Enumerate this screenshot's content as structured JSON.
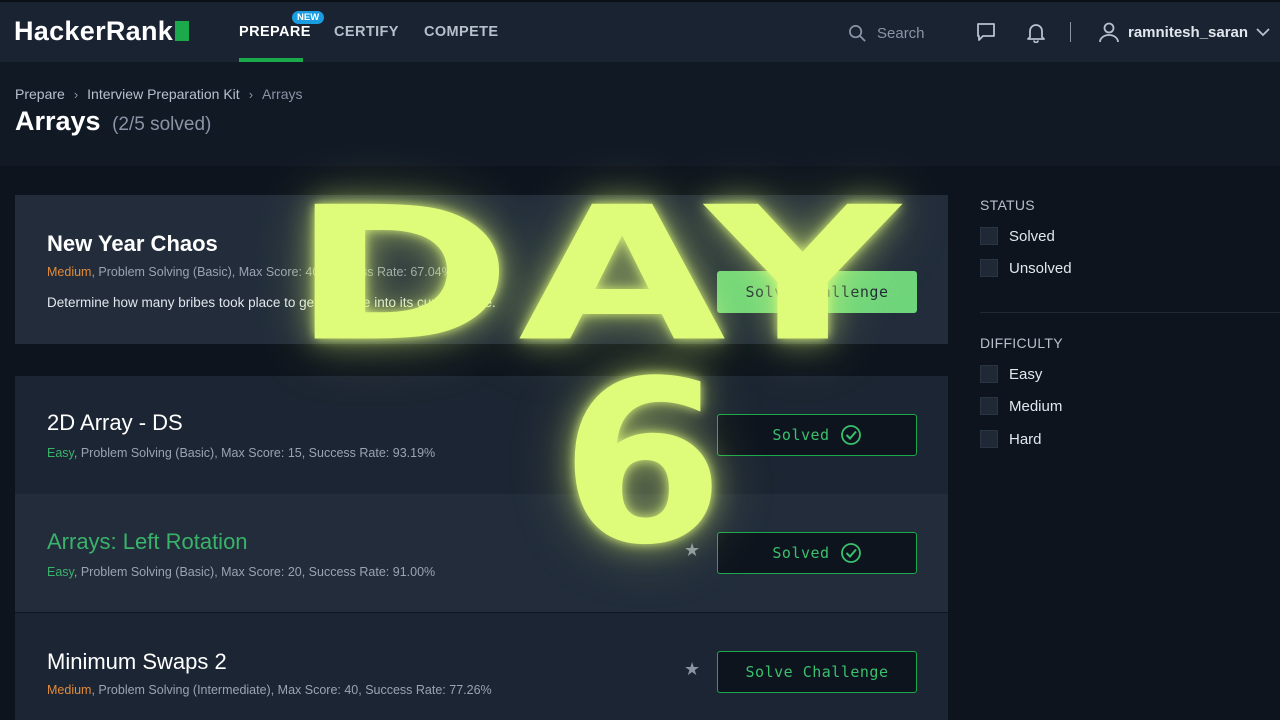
{
  "nav": {
    "logo": "HackerRank",
    "items": [
      {
        "label": "PREPARE",
        "active": true,
        "badge": "NEW"
      },
      {
        "label": "CERTIFY",
        "active": false
      },
      {
        "label": "COMPETE",
        "active": false
      }
    ],
    "search_placeholder": "Search",
    "username": "ramnitesh_saran"
  },
  "breadcrumb": [
    "Prepare",
    "Interview Preparation Kit",
    "Arrays"
  ],
  "page": {
    "title": "Arrays",
    "solved_count": "(2/5 solved)"
  },
  "challenges": [
    {
      "title": "New Year Chaos",
      "difficulty": "Medium",
      "meta": ", Problem Solving (Basic), Max Score: 40, Success Rate: 67.04%",
      "description": "Determine how many bribes took place to get a queue into its current state.",
      "button": "Solve Challenge"
    },
    {
      "title": "2D Array - DS",
      "difficulty": "Easy",
      "meta": ", Problem Solving (Basic), Max Score: 15, Success Rate: 93.19%",
      "button": "Solved"
    },
    {
      "title": "Arrays: Left Rotation",
      "difficulty": "Easy",
      "meta": ", Problem Solving (Basic), Max Score: 20, Success Rate: 91.00%",
      "button": "Solved"
    },
    {
      "title": "Minimum Swaps 2",
      "difficulty": "Medium",
      "meta": ", Problem Solving (Intermediate), Max Score: 40, Success Rate: 77.26%",
      "button": "Solve Challenge"
    }
  ],
  "filters": {
    "status": {
      "heading": "STATUS",
      "options": [
        "Solved",
        "Unsolved"
      ]
    },
    "difficulty": {
      "heading": "DIFFICULTY",
      "options": [
        "Easy",
        "Medium",
        "Hard"
      ]
    }
  },
  "overlay": {
    "word": "DAY",
    "number": "6"
  },
  "colors": {
    "accent": "#1ba94c",
    "overlay": "#dffb7a",
    "medium": "#e28b3a",
    "easy": "#39b36a"
  }
}
